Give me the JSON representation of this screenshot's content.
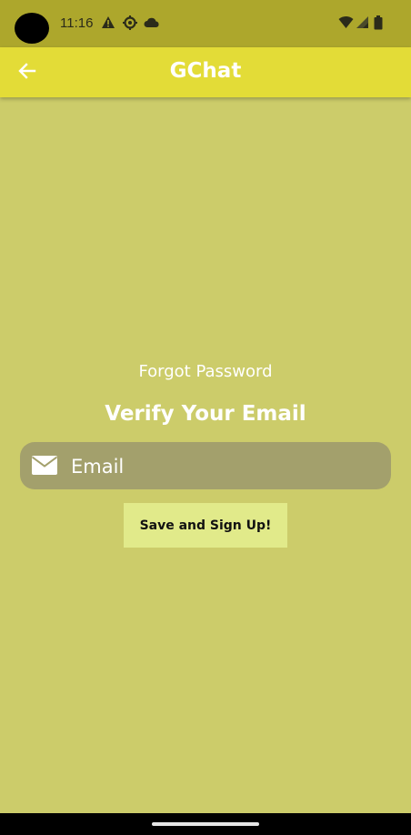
{
  "status_bar": {
    "time": "11:16",
    "icons_left": [
      "warning-icon",
      "settings-icon",
      "cloud-icon"
    ],
    "icons_right": [
      "wifi-icon",
      "signal-icon",
      "battery-icon"
    ]
  },
  "app_bar": {
    "title": "GChat",
    "back_icon": "arrow-back-icon",
    "color": "#e3dc37"
  },
  "main": {
    "subtitle": "Forgot Password",
    "heading": "Verify Your Email",
    "email_field": {
      "icon": "envelope-icon",
      "placeholder": "Email",
      "value": ""
    },
    "submit_label": "Save and Sign Up!"
  },
  "colors": {
    "background": "#cccc6a",
    "status_bar": "#ada72c",
    "field": "#a3a06c",
    "button": "#e1ea8a"
  }
}
